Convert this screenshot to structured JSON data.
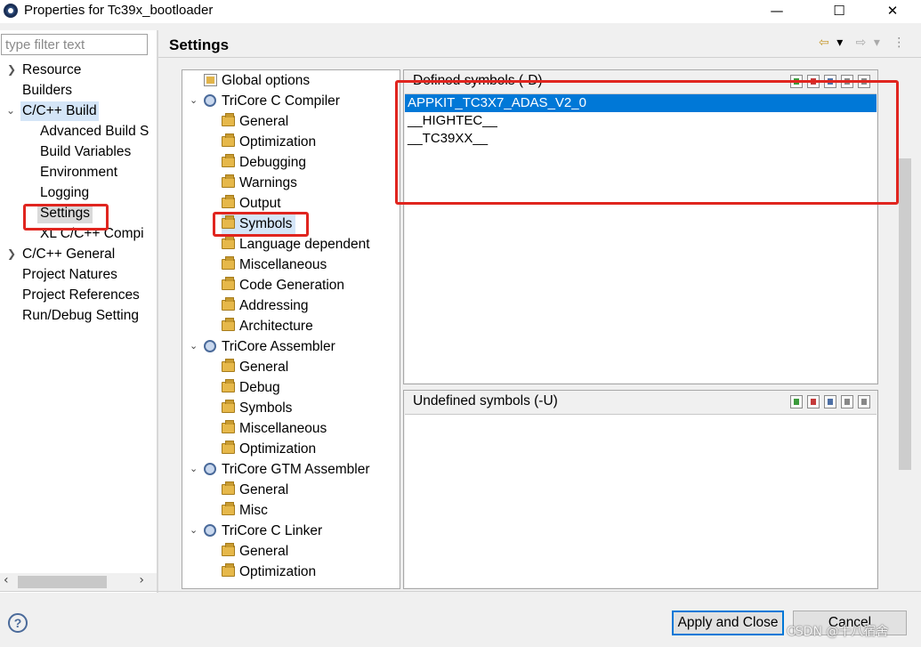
{
  "window": {
    "title": "Properties for Tc39x_bootloader",
    "minimize": "—",
    "maximize": "☐",
    "close": "✕"
  },
  "sidebar": {
    "filter_placeholder": "type filter text",
    "items": [
      {
        "label": "Resource"
      },
      {
        "label": "Builders"
      },
      {
        "label": "C/C++ Build"
      },
      {
        "label": "Advanced Build S"
      },
      {
        "label": "Build Variables"
      },
      {
        "label": "Environment"
      },
      {
        "label": "Logging"
      },
      {
        "label": "Settings"
      },
      {
        "label": "XL C/C++ Compi"
      },
      {
        "label": "C/C++ General"
      },
      {
        "label": "Project Natures"
      },
      {
        "label": "Project References"
      },
      {
        "label": "Run/Debug Setting"
      }
    ],
    "scroll_left": "‹",
    "scroll_right": "›"
  },
  "header": {
    "title": "Settings",
    "back": "⇦",
    "back_menu": "▾",
    "forward": "⇨",
    "forward_menu": "▾",
    "menu": "⋮"
  },
  "tool_tree": [
    {
      "label": "Global options"
    },
    {
      "label": "TriCore C Compiler"
    },
    {
      "label": "General"
    },
    {
      "label": "Optimization"
    },
    {
      "label": "Debugging"
    },
    {
      "label": "Warnings"
    },
    {
      "label": "Output"
    },
    {
      "label": "Symbols"
    },
    {
      "label": "Language dependent"
    },
    {
      "label": "Miscellaneous"
    },
    {
      "label": "Code Generation"
    },
    {
      "label": "Addressing"
    },
    {
      "label": "Architecture"
    },
    {
      "label": "TriCore Assembler"
    },
    {
      "label": "General"
    },
    {
      "label": "Debug"
    },
    {
      "label": "Symbols"
    },
    {
      "label": "Miscellaneous"
    },
    {
      "label": "Optimization"
    },
    {
      "label": "TriCore GTM Assembler"
    },
    {
      "label": "General"
    },
    {
      "label": "Misc"
    },
    {
      "label": "TriCore C Linker"
    },
    {
      "label": "General"
    },
    {
      "label": "Optimization"
    }
  ],
  "defined_symbols": {
    "title": "Defined symbols (-D)",
    "items": [
      "APPKIT_TC3X7_ADAS_V2_0",
      "__HIGHTEC__",
      "__TC39XX__"
    ],
    "selected_index": 0
  },
  "undefined_symbols": {
    "title": "Undefined symbols (-U)",
    "items": []
  },
  "footer": {
    "help": "?",
    "apply_close": "Apply and Close",
    "cancel": "Cancel",
    "watermark": "CSDN @十八宿舍"
  },
  "colors": {
    "selection": "#0078d7",
    "annotation": "#e0251f",
    "tree_highlight": "#d4e5f7"
  }
}
